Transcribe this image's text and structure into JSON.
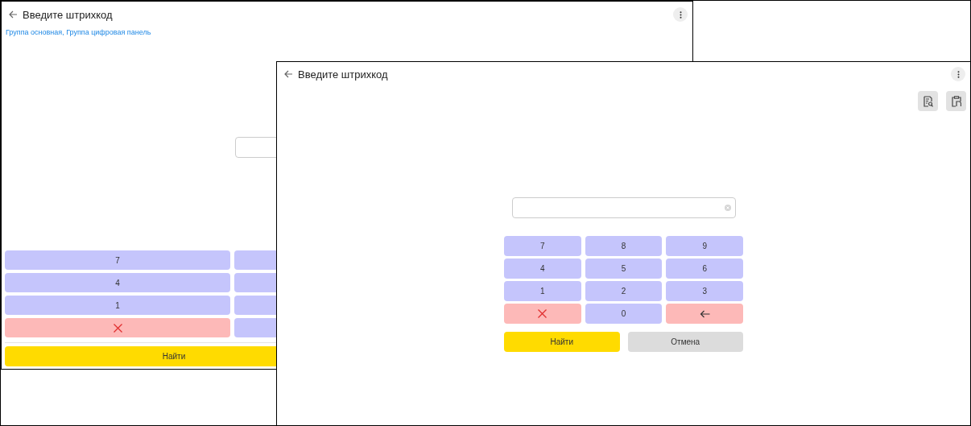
{
  "windows": [
    {
      "kind": "back",
      "title": "Введите штрихкод",
      "subtitle": "Группа основная, Группа цифровая панель",
      "keypad": [
        [
          {
            "kind": "digit",
            "label": "7"
          },
          {
            "kind": "digit"
          }
        ],
        [
          {
            "kind": "digit",
            "label": "4"
          },
          {
            "kind": "digit"
          }
        ],
        [
          {
            "kind": "digit",
            "label": "1"
          },
          {
            "kind": "digit"
          }
        ],
        [
          {
            "kind": "clear"
          },
          {
            "kind": "digit"
          }
        ]
      ],
      "actions": [
        {
          "kind": "primary",
          "label": "Найти"
        }
      ]
    },
    {
      "kind": "front",
      "title": "Введите штрихкод",
      "toolbar": [
        {
          "kind": "document-search"
        },
        {
          "kind": "clipboard"
        }
      ],
      "field": {
        "clear_button": true
      },
      "keypad": [
        [
          {
            "kind": "digit",
            "label": "7"
          },
          {
            "kind": "digit",
            "label": "8"
          },
          {
            "kind": "digit",
            "label": "9"
          }
        ],
        [
          {
            "kind": "digit",
            "label": "4"
          },
          {
            "kind": "digit",
            "label": "5"
          },
          {
            "kind": "digit",
            "label": "6"
          }
        ],
        [
          {
            "kind": "digit",
            "label": "1"
          },
          {
            "kind": "digit",
            "label": "2"
          },
          {
            "kind": "digit",
            "label": "3"
          }
        ],
        [
          {
            "kind": "clear"
          },
          {
            "kind": "digit",
            "label": "0"
          },
          {
            "kind": "backspace"
          }
        ]
      ],
      "actions": [
        {
          "kind": "primary",
          "label": "Найти"
        },
        {
          "kind": "secondary",
          "label": "Отмена"
        }
      ]
    }
  ]
}
